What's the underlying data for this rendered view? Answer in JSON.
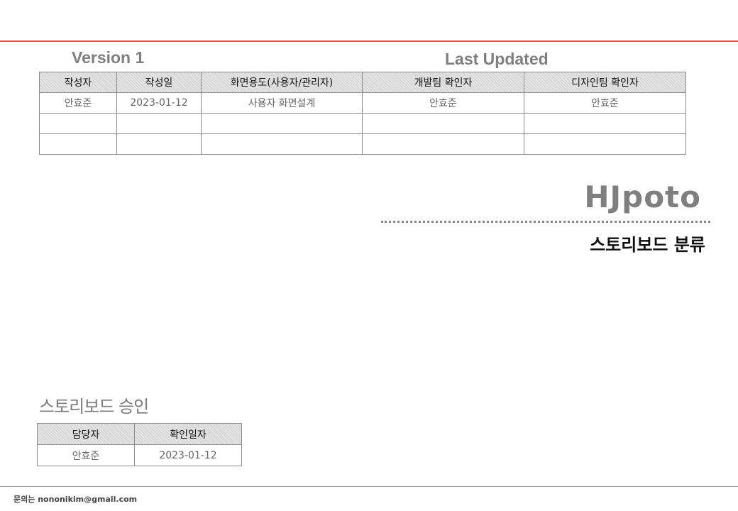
{
  "header": {
    "version": "Version 1",
    "last_updated": "Last Updated"
  },
  "version_table": {
    "headers": [
      "작성자",
      "작성일",
      "화면용도(사용자/관리자)",
      "개발팀 확인자",
      "디자인팀 확인자"
    ],
    "rows": [
      [
        "안효준",
        "2023-01-12",
        "사용자 화면설계",
        "안효준",
        "안효준"
      ],
      [
        "",
        "",
        "",
        "",
        ""
      ],
      [
        "",
        "",
        "",
        "",
        ""
      ]
    ]
  },
  "brand": {
    "title": "HJpoto",
    "subtitle": "스토리보드 분류"
  },
  "approval": {
    "heading": "스토리보드 승인",
    "headers": [
      "담당자",
      "확인일자"
    ],
    "rows": [
      [
        "안효준",
        "2023-01-12"
      ]
    ]
  },
  "footer": {
    "contact": "문의는 nononikim@gmail.com"
  },
  "colors": {
    "accent_rule": "#e05a50",
    "header_fill": "#d6d6d6",
    "muted_text": "#7f7f7f"
  }
}
